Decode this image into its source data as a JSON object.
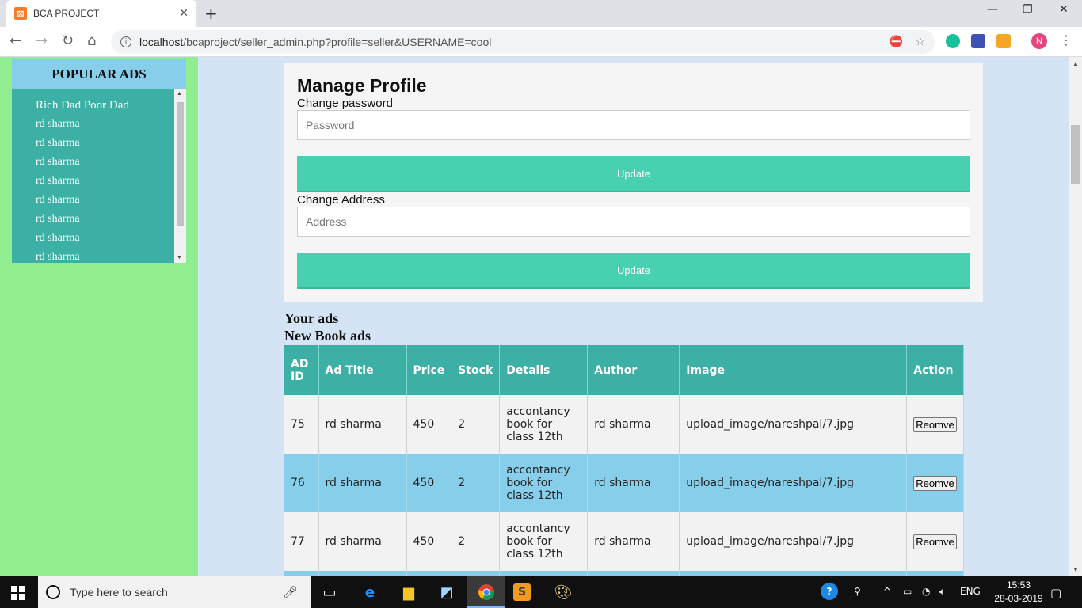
{
  "browser": {
    "tab_title": "BCA PROJECT",
    "url_host": "localhost",
    "url_path": "/bcaproject/seller_admin.php?profile=seller&USERNAME=cool",
    "avatar_letter": "N"
  },
  "sidebar": {
    "heading": "POPULAR ADS",
    "items": [
      "Rich Dad Poor Dad",
      "rd sharma",
      "rd sharma",
      "rd sharma",
      "rd sharma",
      "rd sharma",
      "rd sharma",
      "rd sharma",
      "rd sharma"
    ]
  },
  "profile": {
    "title": "Manage Profile",
    "password_label": "Change password",
    "password_placeholder": "Password",
    "address_label": "Change Address",
    "address_placeholder": "Address",
    "update_label": "Update"
  },
  "ads": {
    "your_ads": "Your ads",
    "new_ads": "New Book ads",
    "columns": [
      "AD ID",
      "Ad Title",
      "Price",
      "Stock",
      "Details",
      "Author",
      "Image",
      "Action"
    ],
    "remove_label": "Reomve",
    "rows": [
      {
        "id": "75",
        "title": "rd sharma",
        "price": "450",
        "stock": "2",
        "details": "accontancy book for class 12th",
        "author": "rd sharma",
        "image": "upload_image/nareshpal/7.jpg"
      },
      {
        "id": "76",
        "title": "rd sharma",
        "price": "450",
        "stock": "2",
        "details": "accontancy book for class 12th",
        "author": "rd sharma",
        "image": "upload_image/nareshpal/7.jpg"
      },
      {
        "id": "77",
        "title": "rd sharma",
        "price": "450",
        "stock": "2",
        "details": "accontancy book for class 12th",
        "author": "rd sharma",
        "image": "upload_image/nareshpal/7.jpg"
      }
    ]
  },
  "taskbar": {
    "search_placeholder": "Type here to search",
    "language": "ENG",
    "time": "15:53",
    "date": "28-03-2019"
  }
}
